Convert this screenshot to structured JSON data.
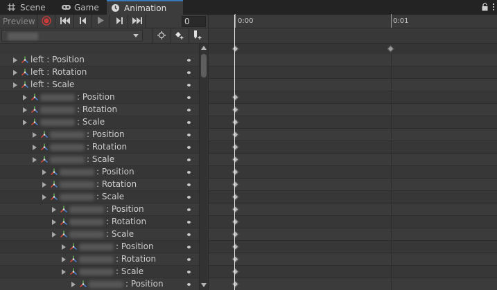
{
  "tabs": [
    {
      "label": "Scene",
      "icon": "grid-icon",
      "active": false
    },
    {
      "label": "Game",
      "icon": "gamepad-icon",
      "active": false
    },
    {
      "label": "Animation",
      "icon": "clock-icon",
      "active": true
    }
  ],
  "toolbar": {
    "preview_label": "Preview",
    "frame_value": "0"
  },
  "ruler": {
    "labels": [
      "0:00",
      "0:01"
    ]
  },
  "colors": {
    "record_red": "#c93b3b",
    "active_tab_accent": "#3a79bb",
    "playhead": "#e8e8e8"
  },
  "properties": [
    {
      "indent": 0,
      "name": "left",
      "blurred": false,
      "prop": ": Position",
      "keyed": false
    },
    {
      "indent": 0,
      "name": "left",
      "blurred": false,
      "prop": ": Rotation",
      "keyed": false
    },
    {
      "indent": 0,
      "name": "left",
      "blurred": false,
      "prop": ": Scale",
      "keyed": false
    },
    {
      "indent": 1,
      "name": "",
      "blurred": true,
      "prop": ": Position",
      "keyed": true
    },
    {
      "indent": 1,
      "name": "",
      "blurred": true,
      "prop": ": Rotation",
      "keyed": true
    },
    {
      "indent": 1,
      "name": "",
      "blurred": true,
      "prop": ": Scale",
      "keyed": true
    },
    {
      "indent": 2,
      "name": "",
      "blurred": true,
      "prop": ": Position",
      "keyed": true
    },
    {
      "indent": 2,
      "name": "",
      "blurred": true,
      "prop": ": Rotation",
      "keyed": true
    },
    {
      "indent": 2,
      "name": "",
      "blurred": true,
      "prop": ": Scale",
      "keyed": true
    },
    {
      "indent": 3,
      "name": "",
      "blurred": true,
      "prop": ": Position",
      "keyed": true
    },
    {
      "indent": 3,
      "name": "",
      "blurred": true,
      "prop": ": Rotation",
      "keyed": true
    },
    {
      "indent": 3,
      "name": "",
      "blurred": true,
      "prop": ": Scale",
      "keyed": true
    },
    {
      "indent": 4,
      "name": "",
      "blurred": true,
      "prop": ": Position",
      "keyed": true
    },
    {
      "indent": 4,
      "name": "",
      "blurred": true,
      "prop": ": Rotation",
      "keyed": true
    },
    {
      "indent": 4,
      "name": "",
      "blurred": true,
      "prop": ": Scale",
      "keyed": true
    },
    {
      "indent": 5,
      "name": "",
      "blurred": true,
      "prop": ": Position",
      "keyed": true
    },
    {
      "indent": 5,
      "name": "",
      "blurred": true,
      "prop": ": Rotation",
      "keyed": true
    },
    {
      "indent": 5,
      "name": "",
      "blurred": true,
      "prop": ": Scale",
      "keyed": true
    },
    {
      "indent": 6,
      "name": "",
      "blurred": true,
      "prop": ": Position",
      "keyed": true
    }
  ]
}
